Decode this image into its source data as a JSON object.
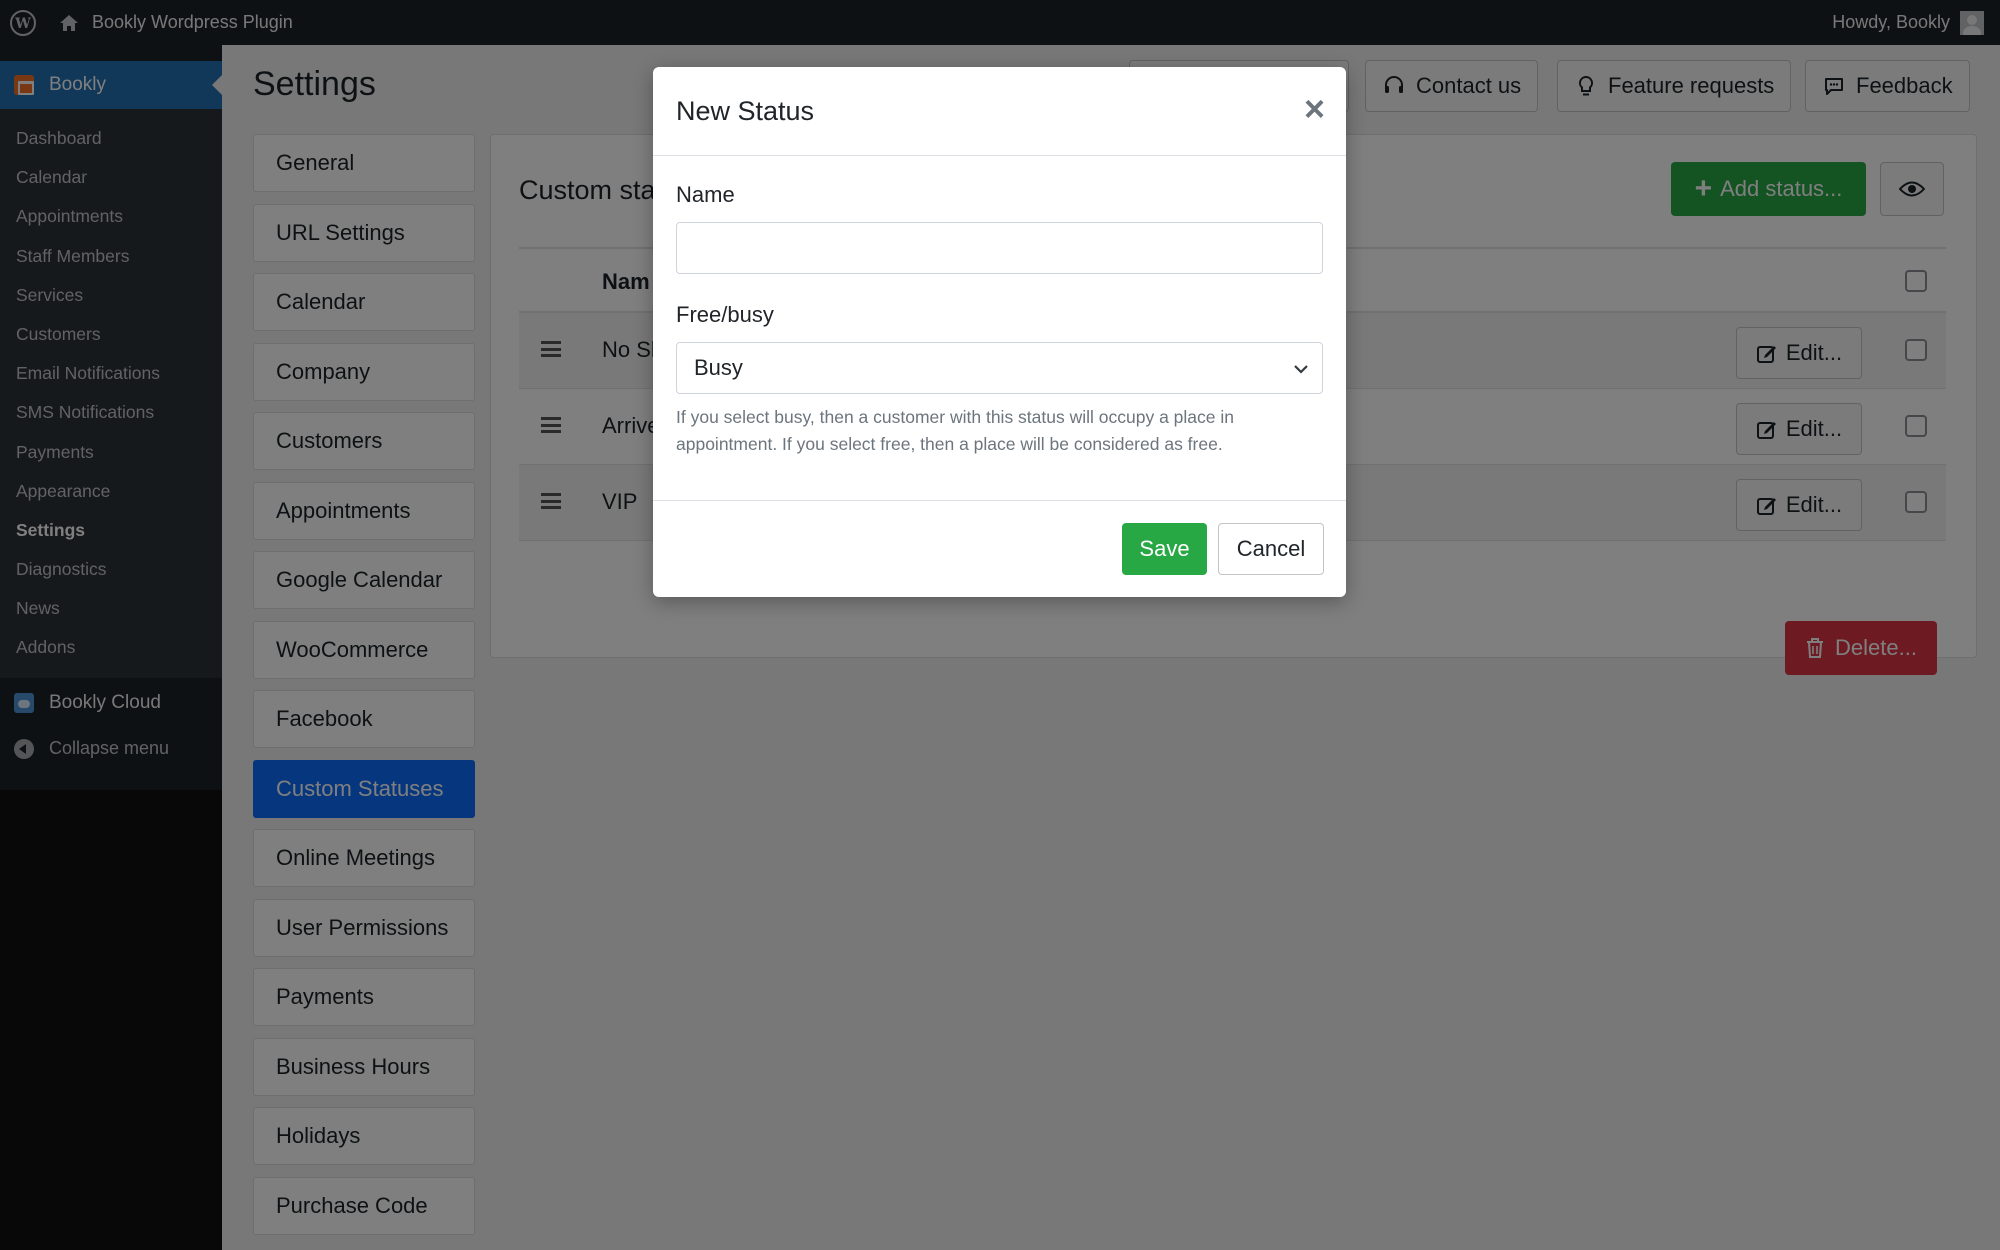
{
  "adminbar": {
    "site_name": "Bookly Wordpress Plugin",
    "howdy": "Howdy, Bookly"
  },
  "adminmenu": {
    "top_label": "Bookly",
    "items": [
      "Dashboard",
      "Calendar",
      "Appointments",
      "Staff Members",
      "Services",
      "Customers",
      "Email Notifications",
      "SMS Notifications",
      "Payments",
      "Appearance",
      "Settings",
      "Diagnostics",
      "News",
      "Addons"
    ],
    "current": "Settings",
    "cloud_label": "Bookly Cloud",
    "collapse_label": "Collapse menu"
  },
  "header": {
    "title": "Settings",
    "contact": "Contact us",
    "feature": "Feature requests",
    "feedback": "Feedback"
  },
  "settings_nav": {
    "items": [
      "General",
      "URL Settings",
      "Calendar",
      "Company",
      "Customers",
      "Appointments",
      "Google Calendar",
      "WooCommerce",
      "Facebook",
      "Custom Statuses",
      "Online Meetings",
      "User Permissions",
      "Payments",
      "Business Hours",
      "Holidays",
      "Purchase Code"
    ],
    "active": "Custom Statuses"
  },
  "panel": {
    "title": "Custom sta",
    "add_button": "Add status...",
    "column_name": "Nam",
    "rows": [
      {
        "name": "No Sh",
        "edit": "Edit..."
      },
      {
        "name": "Arrive",
        "edit": "Edit..."
      },
      {
        "name": "VIP",
        "edit": "Edit..."
      }
    ],
    "delete_button": "Delete..."
  },
  "modal": {
    "title": "New Status",
    "close": "×",
    "name_label": "Name",
    "name_value": "",
    "freebusy_label": "Free/busy",
    "freebusy_value": "Busy",
    "help": "If you select busy, then a customer with this status will occupy a place in appointment. If you select free, then a place will be considered as free.",
    "save": "Save",
    "cancel": "Cancel"
  },
  "colors": {
    "primary": "#0d6efd",
    "success": "#28a745",
    "danger": "#dc3545",
    "wp_blue": "#2271b1",
    "admin_dark": "#1d2327"
  },
  "icons": {
    "wp": "wordpress-icon",
    "home": "home-icon",
    "contact": "headset-icon",
    "feature": "lightbulb-icon",
    "feedback": "chat-icon",
    "eye": "eye-icon",
    "edit": "edit-icon",
    "trash": "trash-icon",
    "handle": "drag-handle-icon"
  }
}
